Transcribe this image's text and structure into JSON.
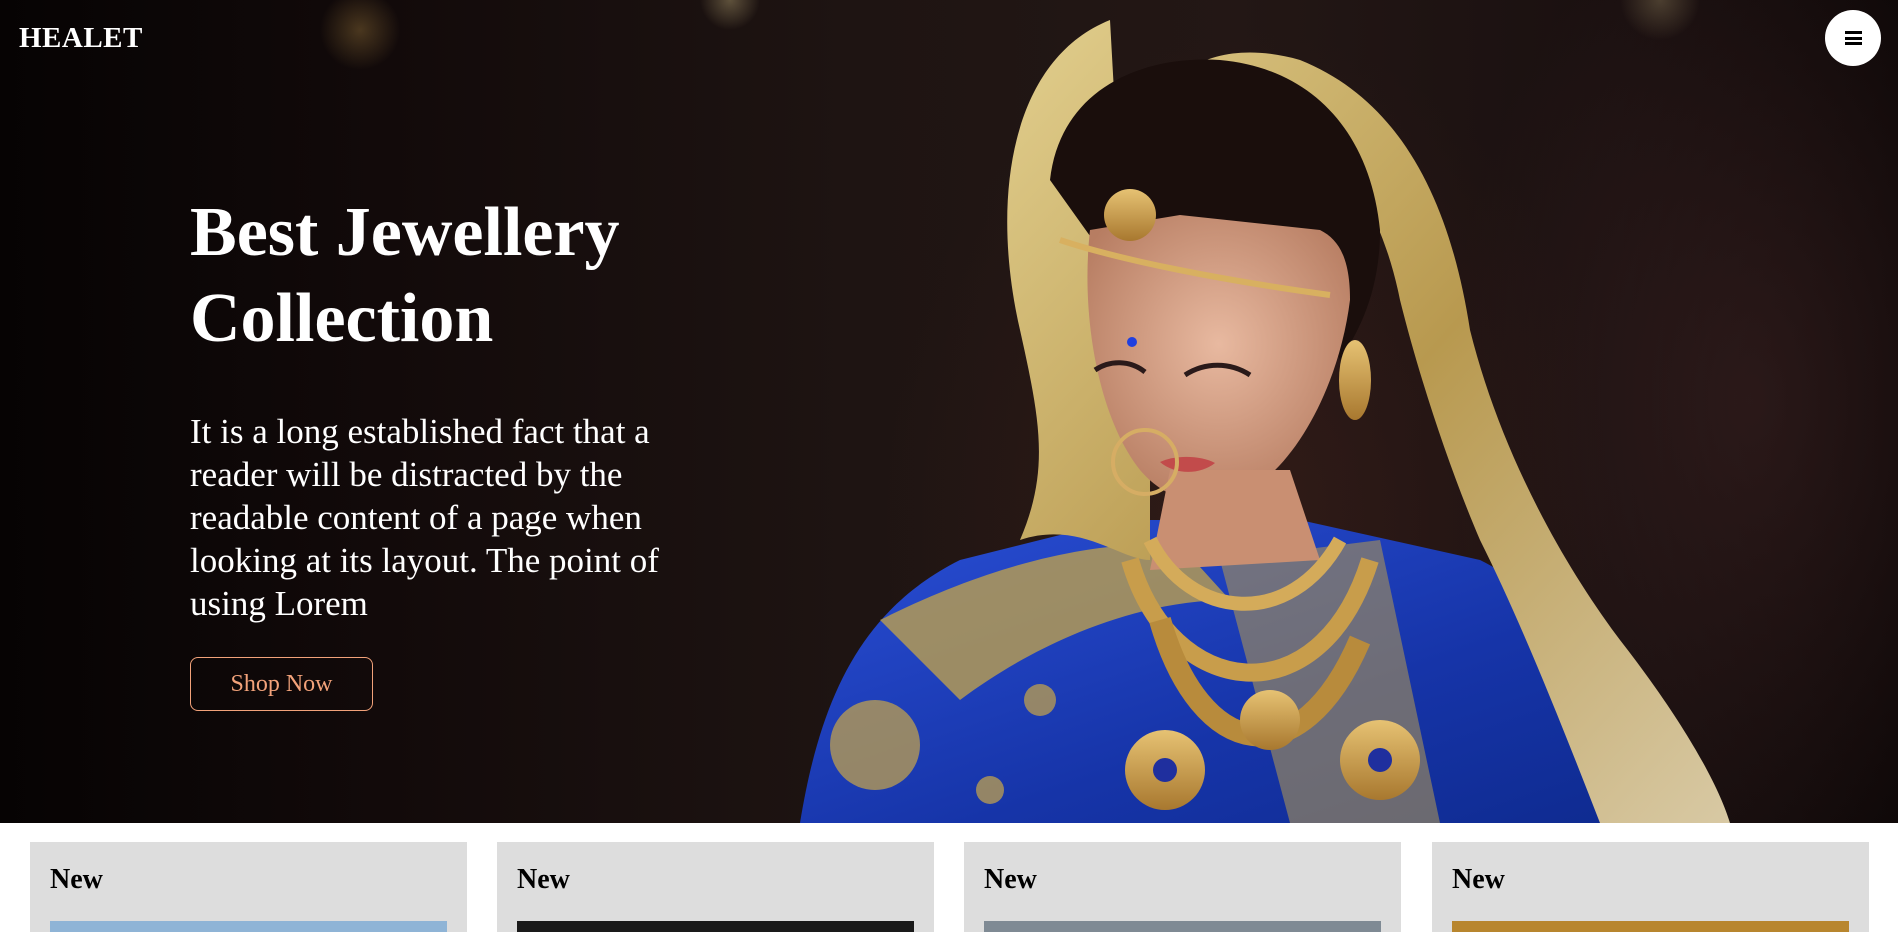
{
  "brand": {
    "logo_text": "HEALET"
  },
  "header": {
    "menu_icon": "hamburger-menu-icon"
  },
  "hero": {
    "title": "Best Jewellery Collection",
    "description": "It is a long established fact that a reader will be distracted by the readable content of a page when looking at its layout. The point of using Lorem",
    "cta_label": "Shop Now",
    "accent_color": "#f2a27a"
  },
  "products": {
    "cards": [
      {
        "label": "New",
        "image_color": "#8fb4d6"
      },
      {
        "label": "New",
        "image_color": "#1a1a1a"
      },
      {
        "label": "New",
        "image_color": "#7f8a94"
      },
      {
        "label": "New",
        "image_color": "#b8862e"
      }
    ]
  },
  "colors": {
    "hero_bg": "#120a0a",
    "saree_blue": "#1f3fb8",
    "gold": "#c9a24a",
    "card_bg": "#dddddd"
  }
}
